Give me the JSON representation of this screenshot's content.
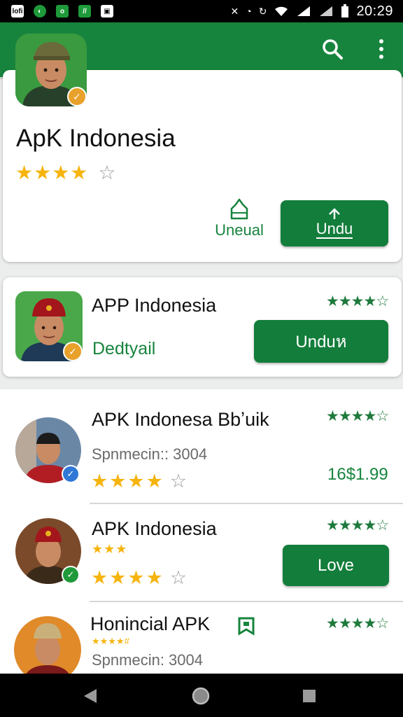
{
  "status_bar": {
    "left_icons": [
      "lofi-app-icon",
      "whatsapp-icon",
      "line-app-icon",
      "app-icon",
      "gallery-icon"
    ],
    "time": "20:29"
  },
  "app_bar": {
    "actions": [
      "search-icon",
      "more-vert-icon"
    ]
  },
  "featured": {
    "title": "ApK Indonesia",
    "rating_stars": 4,
    "secondary_label": "Uneual",
    "primary_button": "Undu"
  },
  "promo": {
    "title": "APP Indonesia",
    "link": "Dedtyail",
    "rating_stars": 4,
    "button": "Unduห"
  },
  "list": [
    {
      "title": "APK Indonesa Bbʼuik",
      "subtitle": "Spnmecin:: 3004",
      "rating_stars": 4,
      "small_rating_stars": 4,
      "price": "16$1.99"
    },
    {
      "title": "APK Indonesia",
      "mini_rating_text": "★★★",
      "rating_stars": 4,
      "small_rating_stars": 4,
      "button": "Love"
    },
    {
      "title": "Honincial APK",
      "mini_rating_text": "★★★★#",
      "subtitle": "Spnmecin: 3004",
      "small_rating_stars": 4
    }
  ],
  "colors": {
    "primary": "#17843d",
    "button": "#137d3b",
    "star": "#f6b40e"
  }
}
